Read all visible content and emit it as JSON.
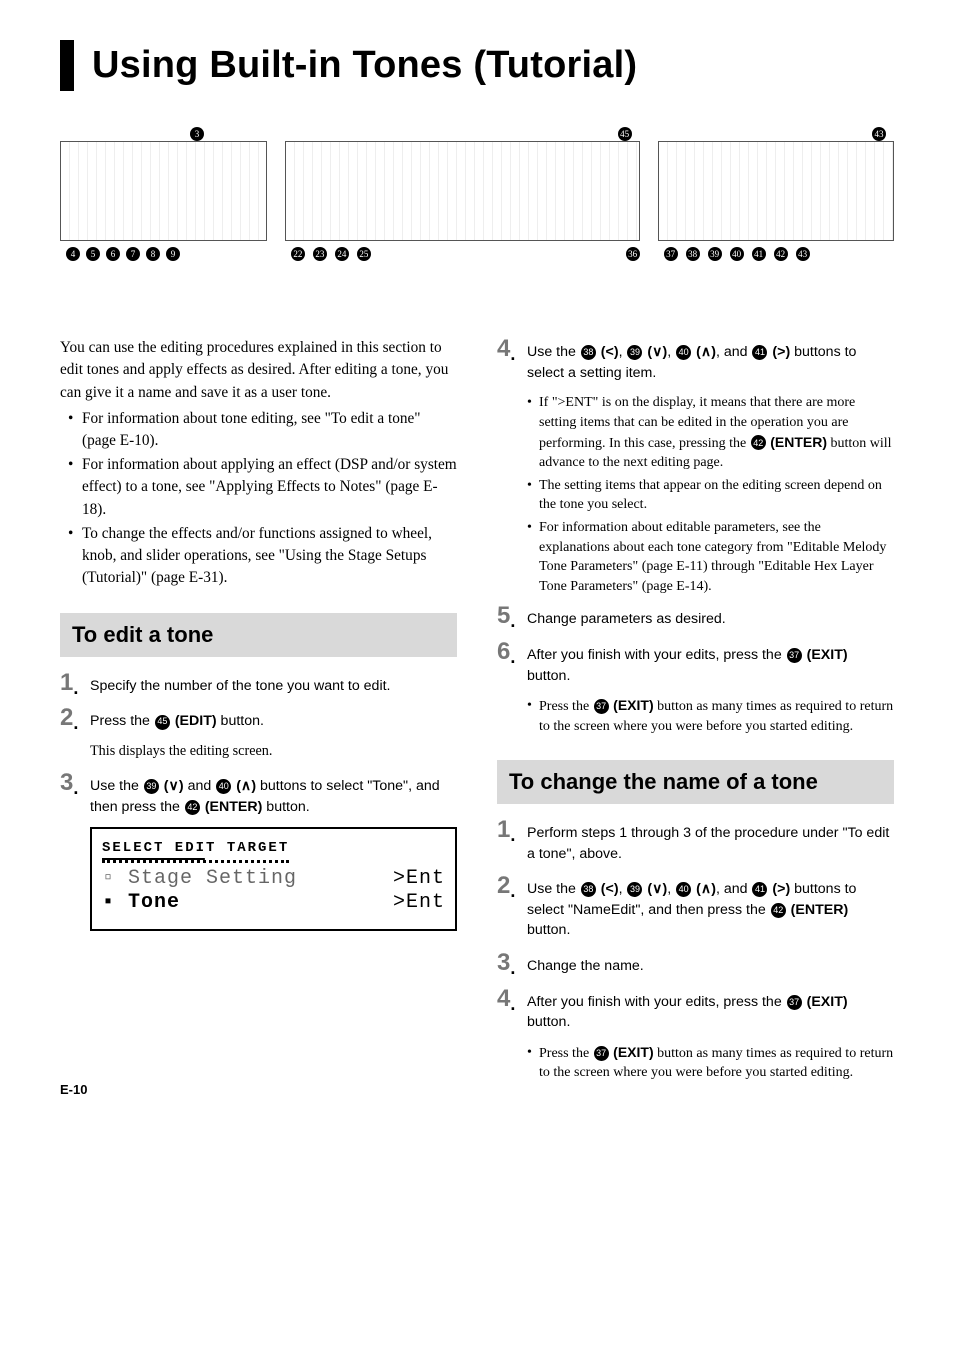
{
  "title": "Using Built-in Tones (Tutorial)",
  "intro": "You can use the editing procedures explained in this section to edit tones and apply effects as desired. After editing a tone, you can give it a name and save it as a user tone.",
  "intro_bullets": [
    "For information about tone editing, see \"To edit a tone\" (page E-10).",
    "For information about applying an effect (DSP and/or system effect) to a tone, see \"Applying Effects to Notes\" (page E-18).",
    "To change the effects and/or functions assigned to wheel, knob, and slider operations, see \"Using the Stage Setups (Tutorial)\" (page E-31)."
  ],
  "section_edit": "To edit a tone",
  "section_rename": "To change the name of a tone",
  "callout_labels": {
    "b3": "3",
    "b4": "4",
    "b5": "5",
    "b6": "6",
    "b7": "7",
    "b8": "8",
    "b9": "9",
    "b22": "22",
    "b23": "23",
    "b24": "24",
    "b25": "25",
    "b36": "36",
    "b37": "37",
    "b38": "38",
    "b39": "39",
    "b40": "40",
    "b41": "41",
    "b42": "42",
    "b43": "43",
    "b45": "45"
  },
  "steps_left": {
    "s1": "Specify the number of the tone you want to edit.",
    "s2_pre": "Press the ",
    "s2_label": "(EDIT)",
    "s2_post": " button.",
    "s2_sub": "This displays the editing screen.",
    "s3_pre": "Use the ",
    "s3_mid": " and ",
    "s3_post1": " buttons to select \"Tone\", and then press the ",
    "s3_label": "(ENTER)",
    "s3_post2": " button."
  },
  "lcd": {
    "header": "SELECT EDIT TARGET",
    "row1_left": "▫ Stage Setting",
    "row1_right": ">Ent",
    "row2_left": "▪ Tone",
    "row2_right": ">Ent"
  },
  "steps_right": {
    "s4_pre": "Use the ",
    "s4_mid1": ", ",
    "s4_mid2": ", ",
    "s4_mid3": ", and ",
    "s4_post": " buttons to select a setting item.",
    "s4_bullets": [
      "If \">ENT\" is on the display, it means that there are more setting items that can be edited in the operation you are performing. In this case, pressing the ㊷ (ENTER) button will advance to the next editing page.",
      "The setting items that appear on the editing screen depend on the tone you select.",
      "For information about editable parameters, see the explanations about each tone category from \"Editable Melody Tone Parameters\" (page E-11) through \"Editable Hex Layer Tone Parameters\" (page E-14)."
    ],
    "s5": "Change parameters as desired.",
    "s6_pre": "After you finish with your edits, press the ",
    "s6_label": "(EXIT)",
    "s6_post": " button.",
    "s6_bullet": "Press the ㊲ (EXIT) button as many times as required to return to the screen where you were before you started editing."
  },
  "rename_steps": {
    "s1": "Perform steps 1 through 3 of the procedure under \"To edit a tone\", above.",
    "s2_pre": "Use the ",
    "s2_mid1": ", ",
    "s2_mid2": ", ",
    "s2_mid3": ", and ",
    "s2_post_a": " buttons to select \"NameEdit\", and then press the ",
    "s2_label": "(ENTER)",
    "s2_post_b": " button.",
    "s3": "Change the name.",
    "s4_pre": "After you finish with your edits, press the ",
    "s4_label": "(EXIT)",
    "s4_post": " button.",
    "s4_bullet": "Press the ㊲ (EXIT) button as many times as required to return to the screen where you were before you started editing."
  },
  "footer": "E-10",
  "arrows": {
    "left": "<",
    "down": "∨",
    "up": "∧",
    "right": ">"
  },
  "paren_open": "(",
  "paren_close": ")",
  "chart_data": {
    "type": "table",
    "title": "Control panel callouts referenced on this page",
    "callouts": [
      3,
      4,
      5,
      6,
      7,
      8,
      9,
      22,
      23,
      24,
      25,
      36,
      37,
      38,
      39,
      40,
      41,
      42,
      43,
      45
    ]
  }
}
